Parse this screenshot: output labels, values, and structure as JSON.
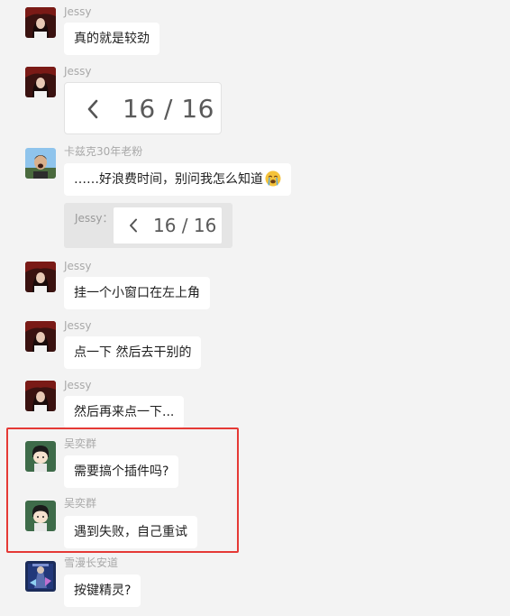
{
  "messages": [
    {
      "sender": "Jessy",
      "text": "真的就是较劲",
      "avatar": "jessy-avatar"
    },
    {
      "sender": "Jessy",
      "image": {
        "chevron": "chevron-left-icon",
        "page": "16 / 16"
      },
      "avatar": "jessy-avatar"
    },
    {
      "sender": "卡兹克30年老粉",
      "text": "……好浪费时间，别问我怎么知道",
      "emoji": "crying-face-emoji",
      "avatar": "fan-avatar",
      "quote": {
        "sender": "Jessy：",
        "page": "16 / 16"
      }
    },
    {
      "sender": "Jessy",
      "text": "挂一个小窗口在左上角",
      "avatar": "jessy-avatar"
    },
    {
      "sender": "Jessy",
      "text": "点一下 然后去干别的",
      "avatar": "jessy-avatar"
    },
    {
      "sender": "Jessy",
      "text": "然后再来点一下...",
      "avatar": "jessy-avatar"
    },
    {
      "sender": "吴奕群",
      "text": "需要搞个插件吗?",
      "avatar": "cartoon-avatar"
    },
    {
      "sender": "吴奕群",
      "text": "遇到失败，自己重试",
      "avatar": "cartoon-avatar"
    },
    {
      "sender": "雪漫长安道",
      "text": "按键精灵?",
      "avatar": "game-avatar"
    }
  ],
  "colors": {
    "background": "#f3f3f3",
    "bubble": "#ffffff",
    "sender_text": "#a9a9a9",
    "highlight": "#e53935"
  }
}
